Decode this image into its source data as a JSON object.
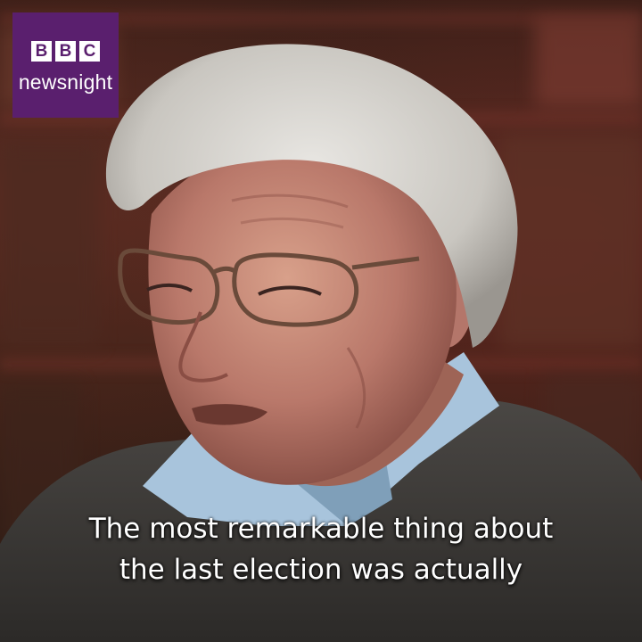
{
  "logo": {
    "blocks": [
      "B",
      "B",
      "C"
    ],
    "name": "newsnight",
    "bg_color": "#5a1f6e"
  },
  "captions": {
    "lines": [
      "The most remarkable thing about",
      "the last election was actually"
    ]
  }
}
